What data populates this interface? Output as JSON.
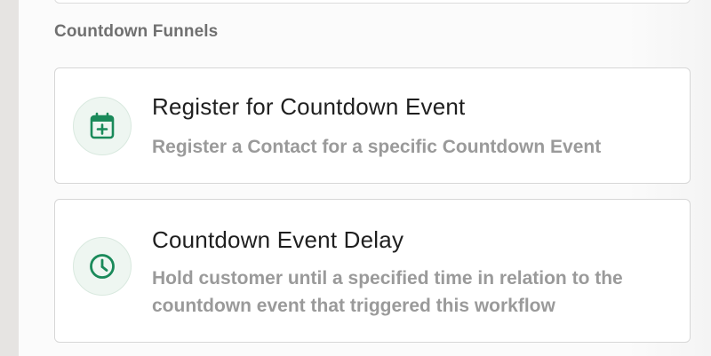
{
  "section": {
    "heading": "Countdown Funnels"
  },
  "actions": [
    {
      "title": "Register for Countdown Event",
      "description": "Register a Contact for a specific Countdown Event",
      "icon": "calendar-plus-icon"
    },
    {
      "title": "Countdown Event Delay",
      "description": "Hold customer until a specified time in relation to the countdown event that triggered this workflow",
      "icon": "clock-icon"
    }
  ],
  "colors": {
    "icon_green": "#1a8a5a",
    "badge_bg": "#eef6f1",
    "heading_gray": "#707070",
    "desc_gray": "#9a9a9a"
  }
}
